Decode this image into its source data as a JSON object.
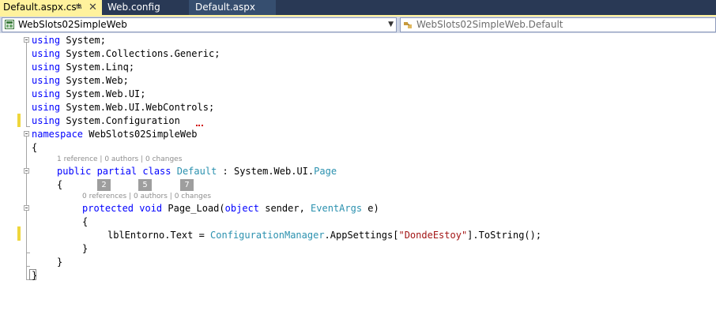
{
  "tabs": [
    {
      "label": "Default.aspx.cs*",
      "active": true
    },
    {
      "label": "Web.config",
      "active": false
    },
    {
      "label": "Default.aspx",
      "active": false
    }
  ],
  "icons": {
    "pin": "pin-icon",
    "close": "close-icon"
  },
  "navbar": {
    "project_combo": "WebSlots02SimpleWeb",
    "member_combo": "WebSlots02SimpleWeb.Default"
  },
  "code": {
    "using1_kw": "using",
    "using1_ns": " System;",
    "using2_kw": "using",
    "using2_ns": " System.Collections.Generic;",
    "using3_kw": "using",
    "using3_ns": " System.Linq;",
    "using4_kw": "using",
    "using4_ns": " System.Web;",
    "using5_kw": "using",
    "using5_ns": " System.Web.UI;",
    "using6_kw": "using",
    "using6_ns": " System.Web.UI.WebControls;",
    "using7_kw": "using",
    "using7_ns": " System.Configuration",
    "ns_kw": "namespace",
    "ns_name": " WebSlots02SimpleWeb",
    "brace_open": "{",
    "class_lens": "1 reference | 0 authors | 0 changes",
    "class_kw": "public partial class",
    "class_name": "Default",
    "class_colon": " : System.Web.UI.",
    "class_base": "Page",
    "class_brace_open": "{",
    "badge_1": "2",
    "badge_2": "5",
    "badge_3": "7",
    "method_lens": "0 references | 0 authors | 0 changes",
    "method_kw": "protected void",
    "method_name": " Page_Load(",
    "method_kw2": "object",
    "method_param1": " sender, ",
    "method_type": "EventArgs",
    "method_param2": " e)",
    "method_brace_open": "{",
    "stmt_start": "lblEntorno.Text = ",
    "stmt_type": "ConfigurationManager",
    "stmt_mid": ".AppSettings[",
    "stmt_str": "\"DondeEstoy\"",
    "stmt_end": "].ToString();",
    "method_brace_close": "}",
    "class_brace_close": "}",
    "brace_close": "}"
  },
  "colors": {
    "keyword": "#0000ff",
    "type": "#2b91af",
    "string": "#a31515",
    "tab_active": "#fff29d",
    "tab_strip": "#293955",
    "change_marker": "#efd63c"
  }
}
